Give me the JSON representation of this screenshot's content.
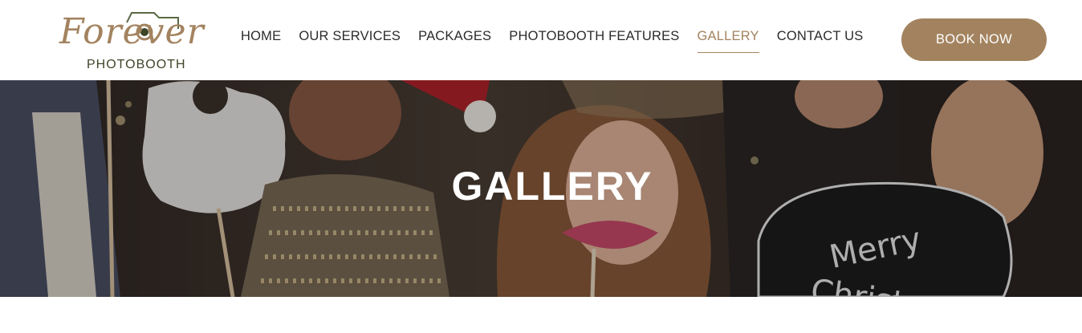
{
  "logo": {
    "script_text": "Forever",
    "subtitle": "PHOTOBOOTH",
    "icon": "camera-icon"
  },
  "nav": {
    "items": [
      {
        "label": "HOME"
      },
      {
        "label": "OUR SERVICES"
      },
      {
        "label": "PACKAGES"
      },
      {
        "label": "PHOTOBOOTH FEATURES"
      },
      {
        "label": "GALLERY",
        "active": true
      },
      {
        "label": "CONTACT US"
      }
    ],
    "cta_label": "BOOK NOW"
  },
  "hero": {
    "title": "GALLERY",
    "sign_text_1": "Merry",
    "sign_text_2": "Christmas"
  },
  "colors": {
    "accent": "#a3835f",
    "logo_subtitle": "#3c4527",
    "nav_text": "#2b2b2b",
    "button_text": "#ffffff",
    "hero_title": "#ffffff"
  }
}
